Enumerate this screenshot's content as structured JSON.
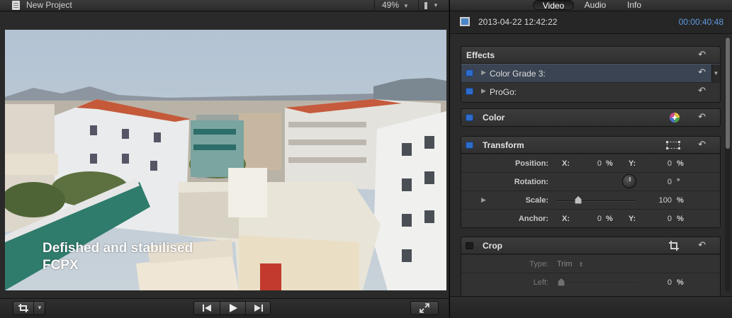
{
  "viewer": {
    "project_title": "New Project",
    "zoom": "49%",
    "overlay_line1": "Defished and stabilised",
    "overlay_line2": "FCPX"
  },
  "inspector": {
    "tabs": [
      "Video",
      "Audio",
      "Info"
    ],
    "active_tab": "Video",
    "clip_date": "2013-04-22 12:42:22",
    "clip_duration": "00:00:40:48",
    "effects": {
      "title": "Effects",
      "items": [
        {
          "label": "Color Grade 3:",
          "enabled": true,
          "selected": true
        },
        {
          "label": "ProGo:",
          "enabled": true,
          "selected": false
        }
      ]
    },
    "color": {
      "title": "Color",
      "enabled": true
    },
    "transform": {
      "title": "Transform",
      "enabled": true,
      "position": {
        "label": "Position:",
        "x_label": "X:",
        "x_value": "0",
        "x_unit": "%",
        "y_label": "Y:",
        "y_value": "0",
        "y_unit": "%"
      },
      "rotation": {
        "label": "Rotation:",
        "value": "0",
        "unit": "°"
      },
      "scale": {
        "label": "Scale:",
        "value": "100",
        "unit": "%"
      },
      "anchor": {
        "label": "Anchor:",
        "x_label": "X:",
        "x_value": "0",
        "x_unit": "%",
        "y_label": "Y:",
        "y_value": "0",
        "y_unit": "%"
      }
    },
    "crop": {
      "title": "Crop",
      "enabled": false,
      "type_label": "Type:",
      "type_value": "Trim",
      "left_label": "Left:",
      "left_value": "0",
      "left_unit": "%"
    }
  },
  "colors": {
    "accent_blue": "#2f6cc9",
    "timecode_blue": "#5f9be0",
    "panel_bg": "#2b2b2b"
  }
}
